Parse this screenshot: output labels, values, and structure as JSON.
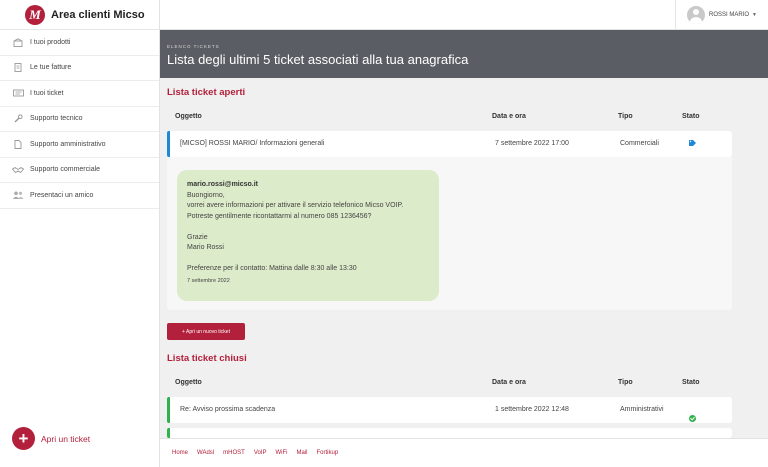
{
  "brand": {
    "title": "Area clienti Micso",
    "logo_letter": "M"
  },
  "sidebar": {
    "items": [
      {
        "label": "I tuoi prodotti",
        "icon": "box-icon"
      },
      {
        "label": "Le tue fatture",
        "icon": "document-icon"
      },
      {
        "label": "I tuoi ticket",
        "icon": "ticket-icon"
      },
      {
        "label": "Supporto tecnico",
        "icon": "wrench-icon"
      },
      {
        "label": "Supporto amministrativo",
        "icon": "file-icon"
      },
      {
        "label": "Supporto commerciale",
        "icon": "handshake-icon"
      },
      {
        "label": "Presentaci un amico",
        "icon": "users-icon"
      }
    ],
    "fab_label": "Apri un ticket"
  },
  "user": {
    "name": "ROSSI MARIO"
  },
  "header": {
    "subtitle": "ELENCO TICKETS",
    "title": "Lista degli ultimi 5 ticket associati alla tua anagrafica"
  },
  "open_tickets": {
    "title": "Lista ticket aperti",
    "columns": [
      "Oggetto",
      "Data e ora",
      "Tipo",
      "Stato"
    ],
    "rows": [
      {
        "subject": "[MICSO] ROSSI MARIO/ Informazioni generali",
        "datetime": "7 settembre 2022 17:00",
        "type": "Commerciali",
        "status_icon": "tag-icon"
      }
    ],
    "message": {
      "from": "mario.rossi@micso.it",
      "lines": [
        "Buongiorno,",
        "vorrei avere informazioni per attivare il servizio telefonico Micso VOIP.",
        "Potreste gentilmente ricontattarmi al numero 085 1236456?"
      ],
      "closing": [
        "Grazie",
        "Mario Rossi"
      ],
      "preference": "Preferenze per il contatto: Mattina dalle 8:30 alle 13:30",
      "date": "7 settembre 2022"
    },
    "new_button": "+ Apri un nuovo ticket"
  },
  "closed_tickets": {
    "title": "Lista ticket chiusi",
    "columns": [
      "Oggetto",
      "Data e ora",
      "Tipo",
      "Stato"
    ],
    "rows": [
      {
        "subject": "Re: Avviso prossima scadenza",
        "datetime": "1 settembre 2022 12:48",
        "type": "Amministrativi",
        "status_icon": "check-circle-icon"
      }
    ]
  },
  "footer": {
    "links": [
      "Home",
      "WAdsl",
      "mHOST",
      "VoIP",
      "WiFi",
      "Mail",
      "Fortikup"
    ]
  },
  "colors": {
    "accent": "#b3203b",
    "header_band": "#5a5e64",
    "open_bar": "#1e88d6",
    "closed_bar": "#2fb24c",
    "message_bg": "#dcebc9"
  }
}
